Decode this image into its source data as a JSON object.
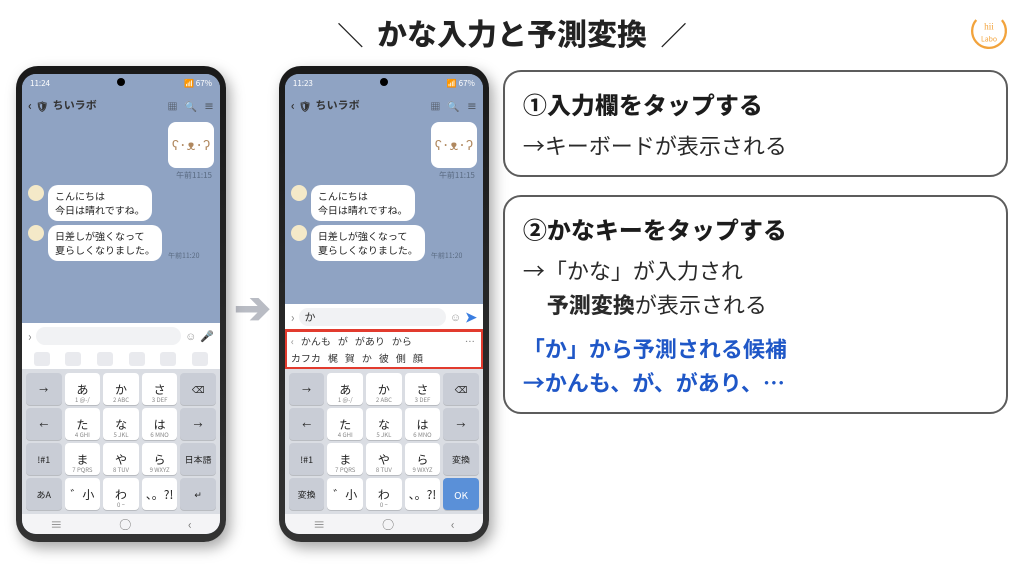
{
  "title": "かな入力と予測変換",
  "logo_text": "Chii Labo",
  "phone_common": {
    "chat_title": "ちいラボ",
    "sticker_time": "午前11:15",
    "msg1": "こんにちは\n今日は晴れですね。",
    "msg2": "日差しが強くなって\n夏らしくなりました。",
    "msg2_time": "午前11:20"
  },
  "phone1": {
    "status_time": "11:24",
    "status_batt": "67%",
    "input_value": ""
  },
  "phone2": {
    "status_time": "11:23",
    "status_batt": "67%",
    "input_value": "か",
    "predict_row1": [
      "かんも",
      "が",
      "があり",
      "から"
    ],
    "predict_row2": [
      "カフカ",
      "梶",
      "賀",
      "か",
      "彼",
      "側",
      "顔"
    ]
  },
  "keyboard": {
    "rows": [
      [
        {
          "m": "→",
          "fn": true
        },
        {
          "m": "あ",
          "s": "1 @-/"
        },
        {
          "m": "か",
          "s": "2 ABC"
        },
        {
          "m": "さ",
          "s": "3 DEF"
        },
        {
          "m": "⌫",
          "fn": true
        }
      ],
      [
        {
          "m": "←",
          "fn": true
        },
        {
          "m": "た",
          "s": "4 GHI"
        },
        {
          "m": "な",
          "s": "5 JKL"
        },
        {
          "m": "は",
          "s": "6 MNO"
        },
        {
          "m": "→",
          "fn": true
        }
      ],
      [
        {
          "m": "!#1",
          "fn": true
        },
        {
          "m": "ま",
          "s": "7 PQRS"
        },
        {
          "m": "や",
          "s": "8 TUV"
        },
        {
          "m": "ら",
          "s": "9 WXYZ"
        },
        {
          "m": "日本語",
          "fn": true,
          "s": ""
        }
      ],
      [
        {
          "m": "あA",
          "fn": true
        },
        {
          "m": "゛小",
          "s": ""
        },
        {
          "m": "わ",
          "s": "0 ~"
        },
        {
          "m": "、。?!",
          "s": ""
        },
        {
          "m": "↵",
          "fn": true
        }
      ]
    ],
    "rows2_lastlabel": "変換",
    "rows2_convert": "変換",
    "rows2_ok": "OK"
  },
  "panels": {
    "p1": {
      "num": "①",
      "head": "入力欄をタップする",
      "line1": "→キーボードが表示される"
    },
    "p2": {
      "num": "②",
      "head": "かなキーをタップする",
      "line1": "→「かな」が入力され",
      "line2_em": "予測変換",
      "line2_rest": "が表示される",
      "blue1": "「か」から予測される候補",
      "blue2": "→かんも、が、があり、…"
    }
  }
}
